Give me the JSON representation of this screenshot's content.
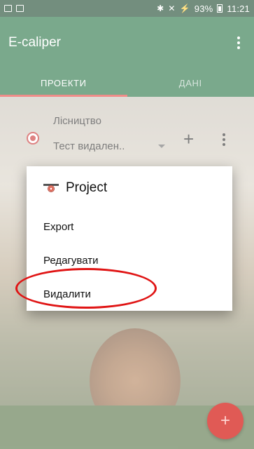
{
  "status_bar": {
    "left_icons": [
      "image-icon",
      "photo-icon"
    ],
    "bluetooth_glyph": "✱",
    "nfc_glyph": "✕",
    "signal_glyph": "⚡",
    "battery": "93%",
    "time": "11:21"
  },
  "toolbar": {
    "title": "E-caliper"
  },
  "tabs": [
    {
      "label": "ПРОЕКТИ",
      "active": true
    },
    {
      "label": "ДАНІ",
      "active": false
    }
  ],
  "project_row": {
    "group_label": "Лісництво",
    "selected_project": "Тест видален..",
    "add_symbol": "+"
  },
  "dialog": {
    "title": "Project",
    "items": [
      {
        "label": "Export"
      },
      {
        "label": "Редагувати"
      },
      {
        "label": "Видалити"
      }
    ]
  },
  "fab": {
    "symbol": "+"
  },
  "colors": {
    "primary": "#1a6b3a",
    "status_bar": "#0f3d22",
    "accent": "#e53935",
    "annotation": "#e01414"
  }
}
